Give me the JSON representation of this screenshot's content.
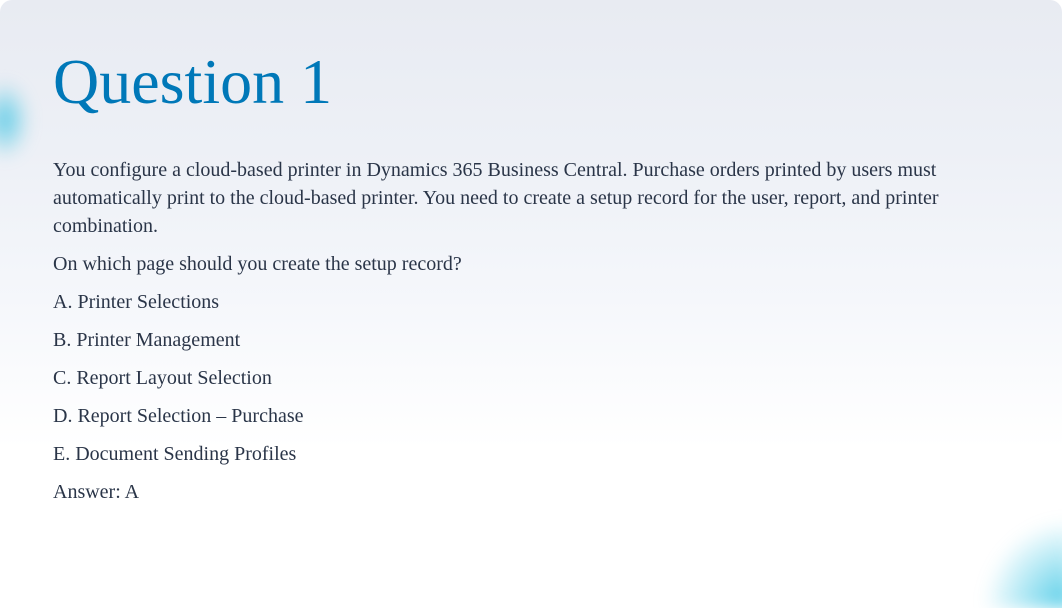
{
  "title": "Question 1",
  "scenario": "You configure a cloud-based printer in Dynamics 365 Business Central. Purchase orders printed by users must automatically print to the cloud-based printer. You need to create a setup record for the user, report, and printer combination.",
  "prompt": "On which page should you create the setup record?",
  "options": {
    "a": "A. Printer Selections",
    "b": "B. Printer Management",
    "c": "C. Report Layout Selection",
    "d": "D. Report Selection – Purchase",
    "e": "E. Document Sending Profiles"
  },
  "answer": "Answer: A"
}
